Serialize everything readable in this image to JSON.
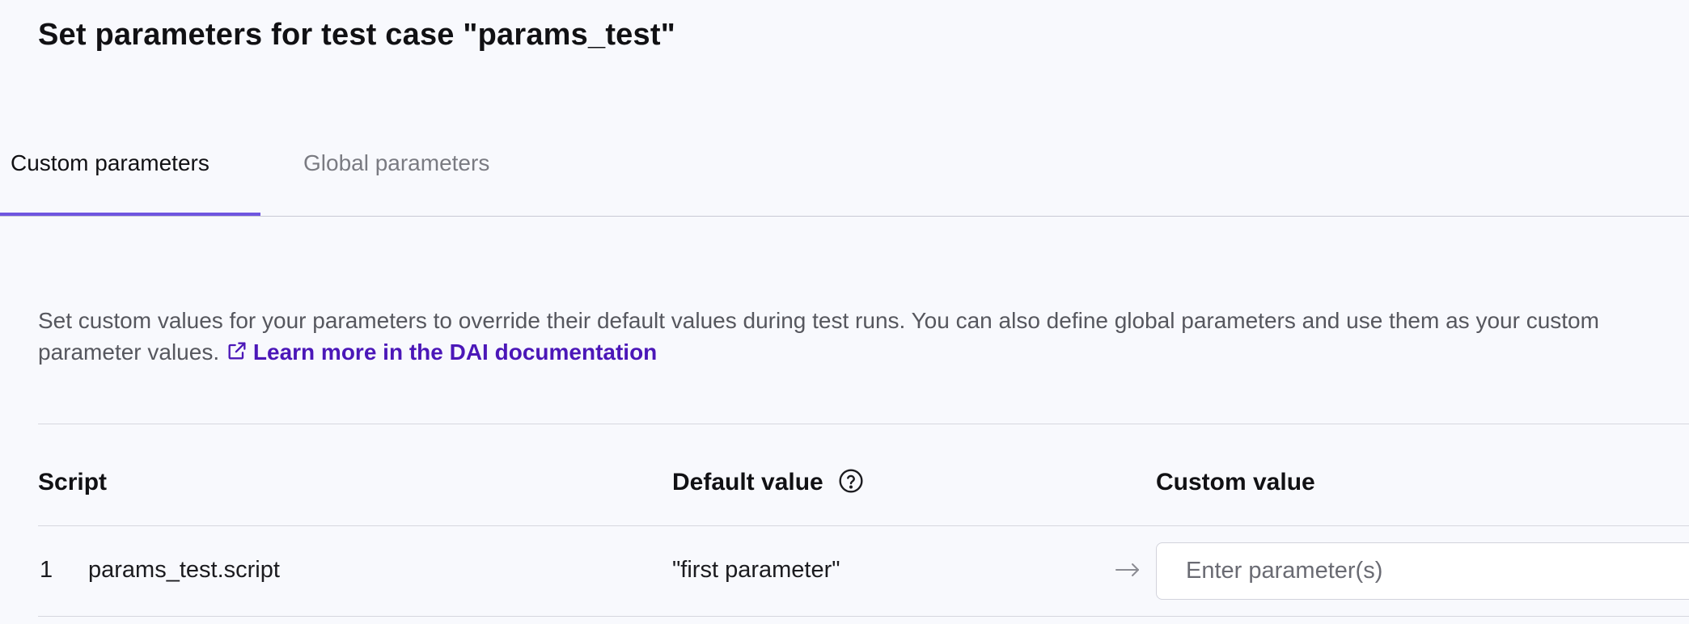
{
  "header": {
    "title": "Set parameters for test case \"params_test\""
  },
  "tabs": [
    {
      "label": "Custom parameters",
      "active": true
    },
    {
      "label": "Global parameters",
      "active": false
    }
  ],
  "description": {
    "text": "Set custom values for your parameters to override their default values during test runs. You can also define global parameters and use them as your custom parameter values.",
    "link_label": "Learn more in the DAI documentation",
    "link_icon": "external-link-icon"
  },
  "table": {
    "columns": {
      "script": "Script",
      "default_value": "Default value",
      "custom_value": "Custom value"
    },
    "help_icon": "question-circle-icon",
    "rows": [
      {
        "index": "1",
        "script": "params_test.script",
        "default_value": "\"first parameter\"",
        "arrow_icon": "right-arrow-icon",
        "custom_value": "",
        "custom_placeholder": "Enter parameter(s)"
      }
    ]
  },
  "colors": {
    "accent": "#6f56e0",
    "link": "#4b17b8",
    "background": "#f8f9fd"
  }
}
